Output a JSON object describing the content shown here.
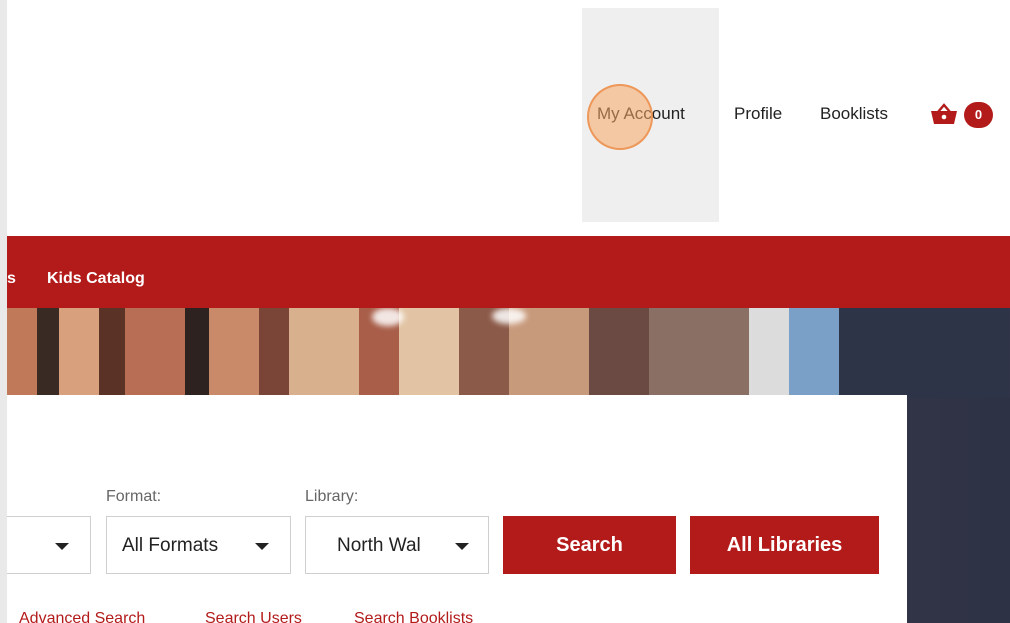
{
  "header": {
    "nav": [
      {
        "label": "My Account"
      },
      {
        "label": "Profile"
      },
      {
        "label": "Booklists"
      }
    ],
    "cart": {
      "icon": "basket-icon",
      "count": "0"
    }
  },
  "menubar": {
    "items": [
      {
        "label": "s"
      },
      {
        "label": "Kids Catalog"
      }
    ]
  },
  "search": {
    "format_label": "Format:",
    "library_label": "Library:",
    "format_value": "All Formats",
    "library_value": "North Wal",
    "search_button": "Search",
    "all_libraries_button": "All Libraries",
    "links": [
      {
        "label": "Advanced Search"
      },
      {
        "label": "Search Users"
      },
      {
        "label": "Search Booklists"
      }
    ]
  },
  "colors": {
    "brand": "#b31b1b",
    "hover_bg": "#efefef"
  }
}
